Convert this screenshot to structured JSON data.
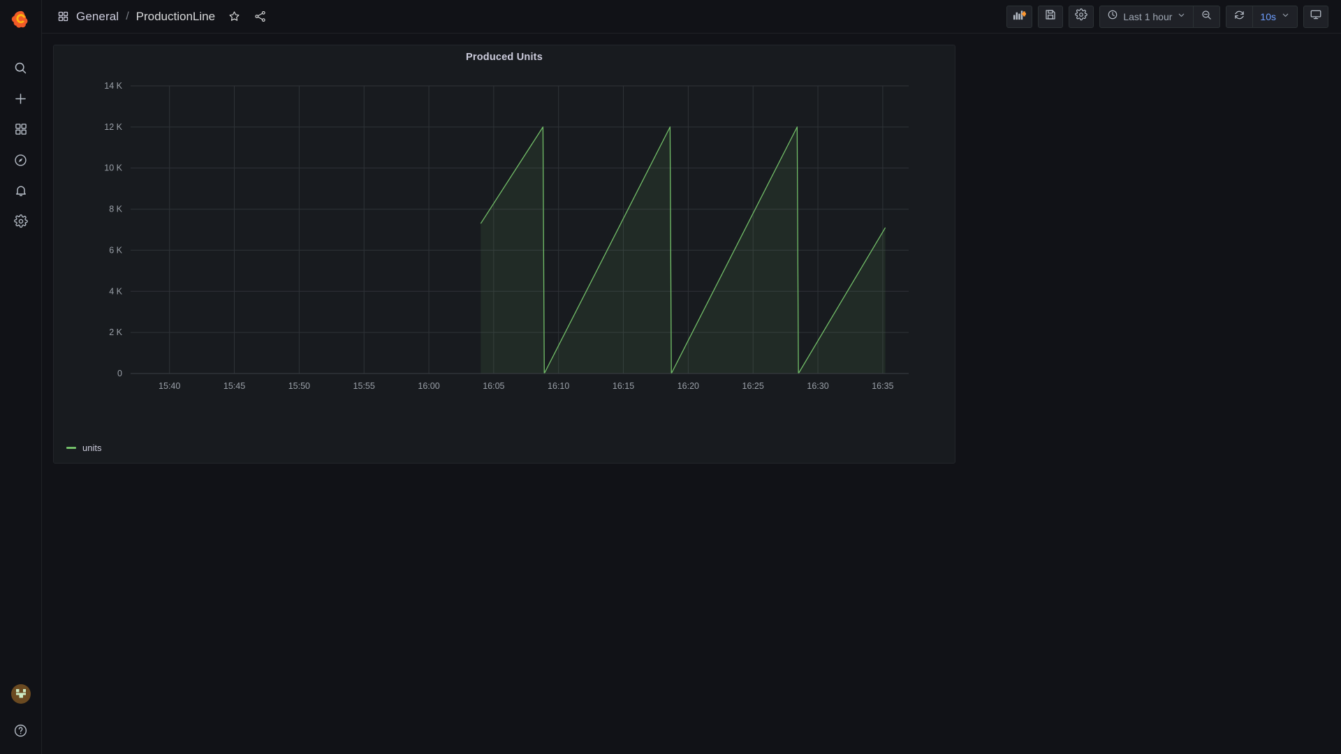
{
  "app": {
    "logo_icon": "grafana-logo-icon",
    "background": "#111217",
    "panel_background": "#181b1f"
  },
  "sidebar": {
    "top_items": [
      {
        "name": "search",
        "icon": "search-icon"
      },
      {
        "name": "create",
        "icon": "plus-icon"
      },
      {
        "name": "dashboards",
        "icon": "grid-icon"
      },
      {
        "name": "explore",
        "icon": "compass-icon"
      },
      {
        "name": "alerting",
        "icon": "bell-icon"
      },
      {
        "name": "config",
        "icon": "gear-icon"
      }
    ],
    "bottom_items": [
      {
        "name": "user-profile",
        "icon": "avatar-icon"
      },
      {
        "name": "help",
        "icon": "question-circle-icon"
      }
    ]
  },
  "breadcrumb": {
    "folder_icon": "dashboards-grid-icon",
    "folder": "General",
    "separator": "/",
    "dashboard": "ProductionLine",
    "star_icon": "star-icon",
    "share_icon": "share-icon"
  },
  "toolbar": {
    "add_panel_icon": "add-panel-icon",
    "save_icon": "save-icon",
    "settings_icon": "gear-icon",
    "time_clock_icon": "clock-icon",
    "time_range": "Last 1 hour",
    "time_chevron_icon": "chevron-down-icon",
    "zoom_out_icon": "zoom-out-icon",
    "refresh_icon": "refresh-icon",
    "refresh_interval": "10s",
    "refresh_chevron_icon": "chevron-down-icon",
    "kiosk_icon": "tv-monitor-icon"
  },
  "panel": {
    "title": "Produced Units",
    "legend": [
      {
        "label": "units",
        "color": "#73bf69"
      }
    ]
  },
  "chart_data": {
    "type": "line",
    "title": "Produced Units",
    "xlabel": "",
    "ylabel": "",
    "grid": true,
    "legend_position": "bottom-left",
    "series_color": "#73bf69",
    "fill_color": "rgba(115,191,105,0.10)",
    "ylim": [
      0,
      14000
    ],
    "ytick_values": [
      0,
      2000,
      4000,
      6000,
      8000,
      10000,
      12000,
      14000
    ],
    "ytick_labels": [
      "0",
      "2 K",
      "4 K",
      "6 K",
      "8 K",
      "10 K",
      "12 K",
      "14 K"
    ],
    "xlim": [
      "15:37",
      "16:37"
    ],
    "xtick_labels": [
      "15:40",
      "15:45",
      "15:50",
      "15:55",
      "16:00",
      "16:05",
      "16:10",
      "16:15",
      "16:20",
      "16:25",
      "16:30",
      "16:35"
    ],
    "series": [
      {
        "name": "units",
        "description": "Sawtooth counter ramping to 12 K then resetting to 0",
        "points": [
          {
            "t": "16:04",
            "v": 7300
          },
          {
            "t": "16:08.8",
            "v": 12000
          },
          {
            "t": "16:08.9",
            "v": 0
          },
          {
            "t": "16:18.6",
            "v": 12000
          },
          {
            "t": "16:18.7",
            "v": 0
          },
          {
            "t": "16:28.4",
            "v": 12000
          },
          {
            "t": "16:28.5",
            "v": 0
          },
          {
            "t": "16:35.2",
            "v": 7100
          }
        ]
      }
    ]
  }
}
